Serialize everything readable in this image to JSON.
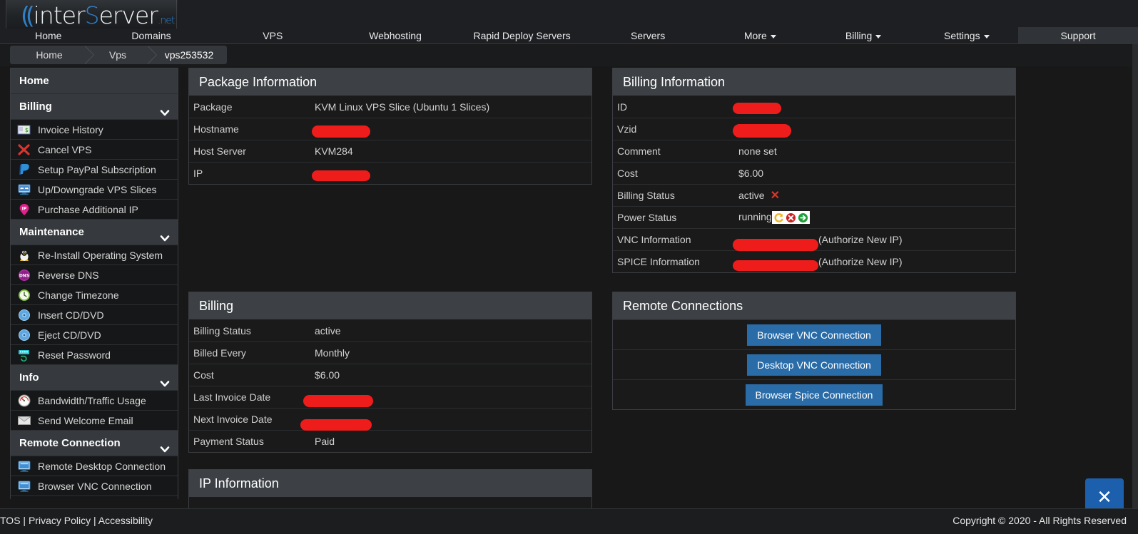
{
  "brand": {
    "logo_prefix": "inter",
    "logo_s": "S",
    "logo_suffix": "erver",
    "logo_tld": ".net"
  },
  "nav": {
    "items": [
      {
        "label": "Home",
        "caret": false,
        "selected": false
      },
      {
        "label": "Domains",
        "caret": false,
        "selected": false
      },
      {
        "label": "VPS",
        "caret": false,
        "selected": false
      },
      {
        "label": "Webhosting",
        "caret": false,
        "selected": false
      },
      {
        "label": "Rapid Deploy Servers",
        "caret": false,
        "selected": false
      },
      {
        "label": "Servers",
        "caret": false,
        "selected": false
      },
      {
        "label": "More",
        "caret": true,
        "selected": false
      },
      {
        "label": "Billing",
        "caret": true,
        "selected": false
      },
      {
        "label": "Settings",
        "caret": true,
        "selected": false
      },
      {
        "label": "Support",
        "caret": false,
        "selected": true
      }
    ]
  },
  "breadcrumb": {
    "items": [
      {
        "label": "Home"
      },
      {
        "label": "Vps"
      },
      {
        "label": "vps253532"
      }
    ]
  },
  "sidebar": {
    "groups": [
      {
        "header": "Home",
        "has_chevron": false,
        "items": []
      },
      {
        "header": "Billing",
        "has_chevron": true,
        "items": [
          {
            "label": "Invoice History",
            "icon": "invoice-book-icon"
          },
          {
            "label": "Cancel VPS",
            "icon": "red-x-icon"
          },
          {
            "label": "Setup PayPal Subscription",
            "icon": "paypal-icon"
          },
          {
            "label": "Up/Downgrade VPS Slices",
            "icon": "monitor-arrows-icon"
          },
          {
            "label": "Purchase Additional IP",
            "icon": "ip-pin-icon"
          }
        ]
      },
      {
        "header": "Maintenance",
        "has_chevron": true,
        "items": [
          {
            "label": "Re-Install Operating System",
            "icon": "linux-tux-icon"
          },
          {
            "label": "Reverse DNS",
            "icon": "dns-badge-icon"
          },
          {
            "label": "Change Timezone",
            "icon": "clock-icon"
          },
          {
            "label": "Insert CD/DVD",
            "icon": "disc-icon"
          },
          {
            "label": "Eject CD/DVD",
            "icon": "disc-icon"
          },
          {
            "label": "Reset Password",
            "icon": "keyboard-reset-icon"
          }
        ]
      },
      {
        "header": "Info",
        "has_chevron": true,
        "items": [
          {
            "label": "Bandwidth/Traffic Usage",
            "icon": "gauge-icon"
          },
          {
            "label": "Send Welcome Email",
            "icon": "envelope-icon"
          }
        ]
      },
      {
        "header": "Remote Connection",
        "has_chevron": true,
        "items": [
          {
            "label": "Remote Desktop Connection",
            "icon": "monitor-icon"
          },
          {
            "label": "Browser VNC Connection",
            "icon": "monitor-icon"
          },
          {
            "label": "",
            "icon": "monitor-icon"
          }
        ]
      }
    ]
  },
  "package_information": {
    "title": "Package Information",
    "rows": [
      {
        "key": "Package",
        "value": "KVM Linux VPS Slice (Ubuntu 1 Slices)",
        "redacted": false
      },
      {
        "key": "Hostname",
        "value": "",
        "redacted": true
      },
      {
        "key": "Host Server",
        "value": "KVM284",
        "redacted": false
      },
      {
        "key": "IP",
        "value": "",
        "redacted": true
      }
    ]
  },
  "billing_information": {
    "title": "Billing Information",
    "rows": [
      {
        "key": "ID",
        "value": "",
        "redacted": true
      },
      {
        "key": "Vzid",
        "value": "",
        "redacted": true
      },
      {
        "key": "Comment",
        "value": "none set",
        "redacted": false
      },
      {
        "key": "Cost",
        "value": "$6.00",
        "redacted": false
      },
      {
        "key": "Billing Status",
        "value": "active",
        "redacted": false,
        "status_icon": "red-x-icon"
      },
      {
        "key": "Power Status",
        "value": "running",
        "redacted": false,
        "power_icons": [
          "restart-icon",
          "stop-icon",
          "start-icon"
        ]
      },
      {
        "key": "VNC Information",
        "value": "",
        "redacted": true,
        "suffix": "(Authorize New IP)"
      },
      {
        "key": "SPICE Information",
        "value": "",
        "redacted": true,
        "suffix": "(Authorize New IP)"
      }
    ]
  },
  "billing": {
    "title": "Billing",
    "rows": [
      {
        "key": "Billing Status",
        "value": "active",
        "redacted": false
      },
      {
        "key": "Billed Every",
        "value": "Monthly",
        "redacted": false
      },
      {
        "key": "Cost",
        "value": "$6.00",
        "redacted": false
      },
      {
        "key": "Last Invoice Date",
        "value": "",
        "redacted": true
      },
      {
        "key": "Next Invoice Date",
        "value": "",
        "redacted": true
      },
      {
        "key": "Payment Status",
        "value": "Paid",
        "redacted": false
      }
    ]
  },
  "remote_connections": {
    "title": "Remote Connections",
    "buttons": [
      {
        "label": "Browser VNC Connection"
      },
      {
        "label": "Desktop VNC Connection"
      },
      {
        "label": "Browser Spice Connection"
      }
    ]
  },
  "ip_information": {
    "title": "IP Information"
  },
  "footer": {
    "links": [
      "TOS",
      "Privacy Policy",
      "Accessibility"
    ],
    "separator": "|",
    "copyright": "Copyright © 2020 - All Rights Reserved"
  },
  "close_button": {
    "glyph": "✕"
  },
  "colors": {
    "accent_blue": "#2a6ca8",
    "fab_blue": "#1c5fad",
    "panel_header": "#3d4145",
    "panel_body": "#1a1a1a",
    "redaction_red": "#ef1c1c",
    "page_bg": "#181818"
  }
}
